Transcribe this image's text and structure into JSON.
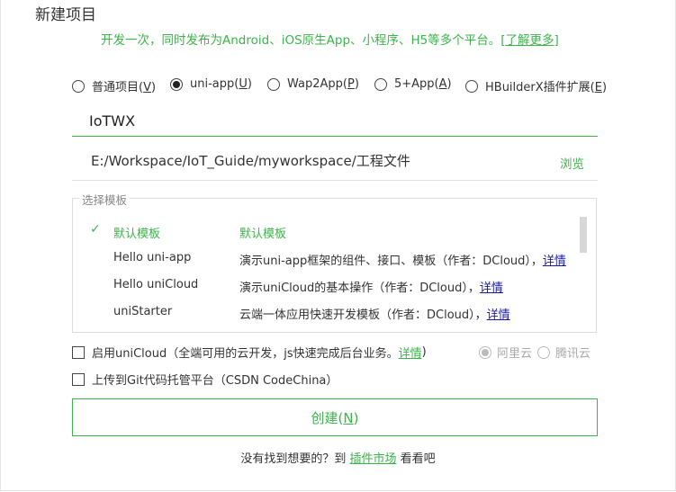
{
  "dialog": {
    "title": "新建项目",
    "subtitle": "开发一次，同时发布为Android、iOS原生App、小程序、H5等多个平台。",
    "learn_more": "[了解更多]"
  },
  "project_types": [
    {
      "label": "普通项目(",
      "key": "V",
      "suffix": ")",
      "checked": false
    },
    {
      "label": "uni-app(",
      "key": "U",
      "suffix": ")",
      "checked": true
    },
    {
      "label": "Wap2App(",
      "key": "P",
      "suffix": ")",
      "checked": false
    },
    {
      "label": "5+App(",
      "key": "A",
      "suffix": ")",
      "checked": false
    },
    {
      "label": "HBuilderX插件扩展(",
      "key": "E",
      "suffix": ")",
      "checked": false
    }
  ],
  "project_name": {
    "value": "IoTWX"
  },
  "project_path": {
    "value": "E:/Workspace/IoT_Guide/myworkspace/工程文件",
    "browse_label": "浏览"
  },
  "templates": {
    "legend": "选择模板",
    "items": [
      {
        "name": "默认模板",
        "desc": "默认模板",
        "detail": "",
        "selected": true
      },
      {
        "name": "Hello uni-app",
        "desc": "演示uni-app框架的组件、接口、模板（作者：DCloud），",
        "detail": "详情",
        "selected": false
      },
      {
        "name": "Hello uniCloud",
        "desc": "演示uniCloud的基本操作（作者：DCloud），",
        "detail": "详情",
        "selected": false
      },
      {
        "name": "uniStarter",
        "desc": "云端一体应用快速开发模板（作者：DCloud），",
        "detail": "详情",
        "selected": false
      }
    ]
  },
  "unicloud": {
    "label": "启用uniCloud（全端可用的云开发，js快速完成后台业务。",
    "detail": "详情",
    "suffix": ")",
    "providers": [
      {
        "label": "阿里云",
        "checked": true
      },
      {
        "label": "腾讯云",
        "checked": false
      }
    ]
  },
  "git": {
    "label": "上传到Git代码托管平台（CSDN CodeChina）"
  },
  "create_button": {
    "label": "创建(",
    "key": "N",
    "suffix": ")"
  },
  "footer": {
    "prefix": "没有找到想要的？到 ",
    "link": "插件市场",
    "suffix": " 看看吧"
  },
  "colors": {
    "accent": "#3bb54a",
    "link": "#1a1aa6"
  }
}
